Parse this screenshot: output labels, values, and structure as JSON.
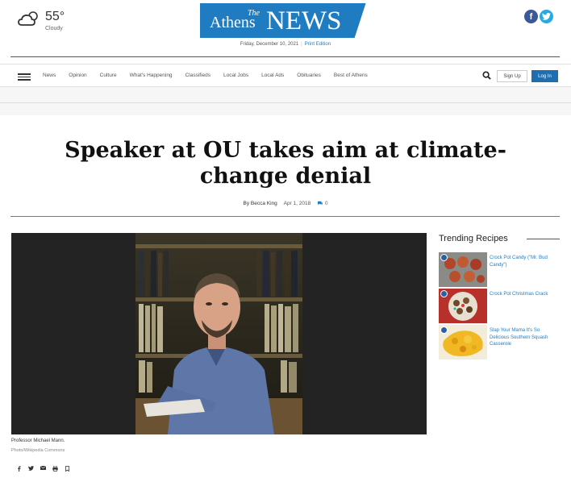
{
  "weather": {
    "temperature": "55°",
    "condition": "Cloudy",
    "icon": "cloud-sun-icon"
  },
  "logo": {
    "the": "The",
    "athens": "Athens",
    "news": "NEWS"
  },
  "dateline": {
    "date": "Friday, December 10, 2021",
    "separator": "|",
    "print_edition": "Print Edition"
  },
  "social": {
    "facebook": "f",
    "twitter": "t"
  },
  "nav": {
    "items": [
      "News",
      "Opinion",
      "Culture",
      "What's Happening",
      "Classifieds",
      "Local Jobs",
      "Local Ads",
      "Obituaries",
      "Best of Athens"
    ],
    "sign_up": "Sign Up",
    "log_in": "Log In"
  },
  "article": {
    "headline": "Speaker at OU takes aim at climate-change denial",
    "byline": "By Becca King",
    "date": "Apr 1, 2018",
    "comments": "0",
    "caption": "Professor Michael Mann.",
    "credit": "Photo/Wikipedia Commons"
  },
  "share": [
    "facebook-icon",
    "twitter-icon",
    "email-icon",
    "print-icon",
    "bookmark-icon"
  ],
  "sidebar": {
    "title": "Trending Recipes",
    "recipes": [
      {
        "title": "Crock Pot Candy (\"Mr. Bud Candy\")"
      },
      {
        "title": "Crock Pot Christmas Crack"
      },
      {
        "title": "Slap Your Mama It's So Delicious Southern Squash Casserole"
      }
    ]
  },
  "colors": {
    "brand_blue": "#1f7cc1",
    "login_bg": "#1f6fb0",
    "facebook": "#3b5998",
    "twitter": "#29a9e1"
  }
}
